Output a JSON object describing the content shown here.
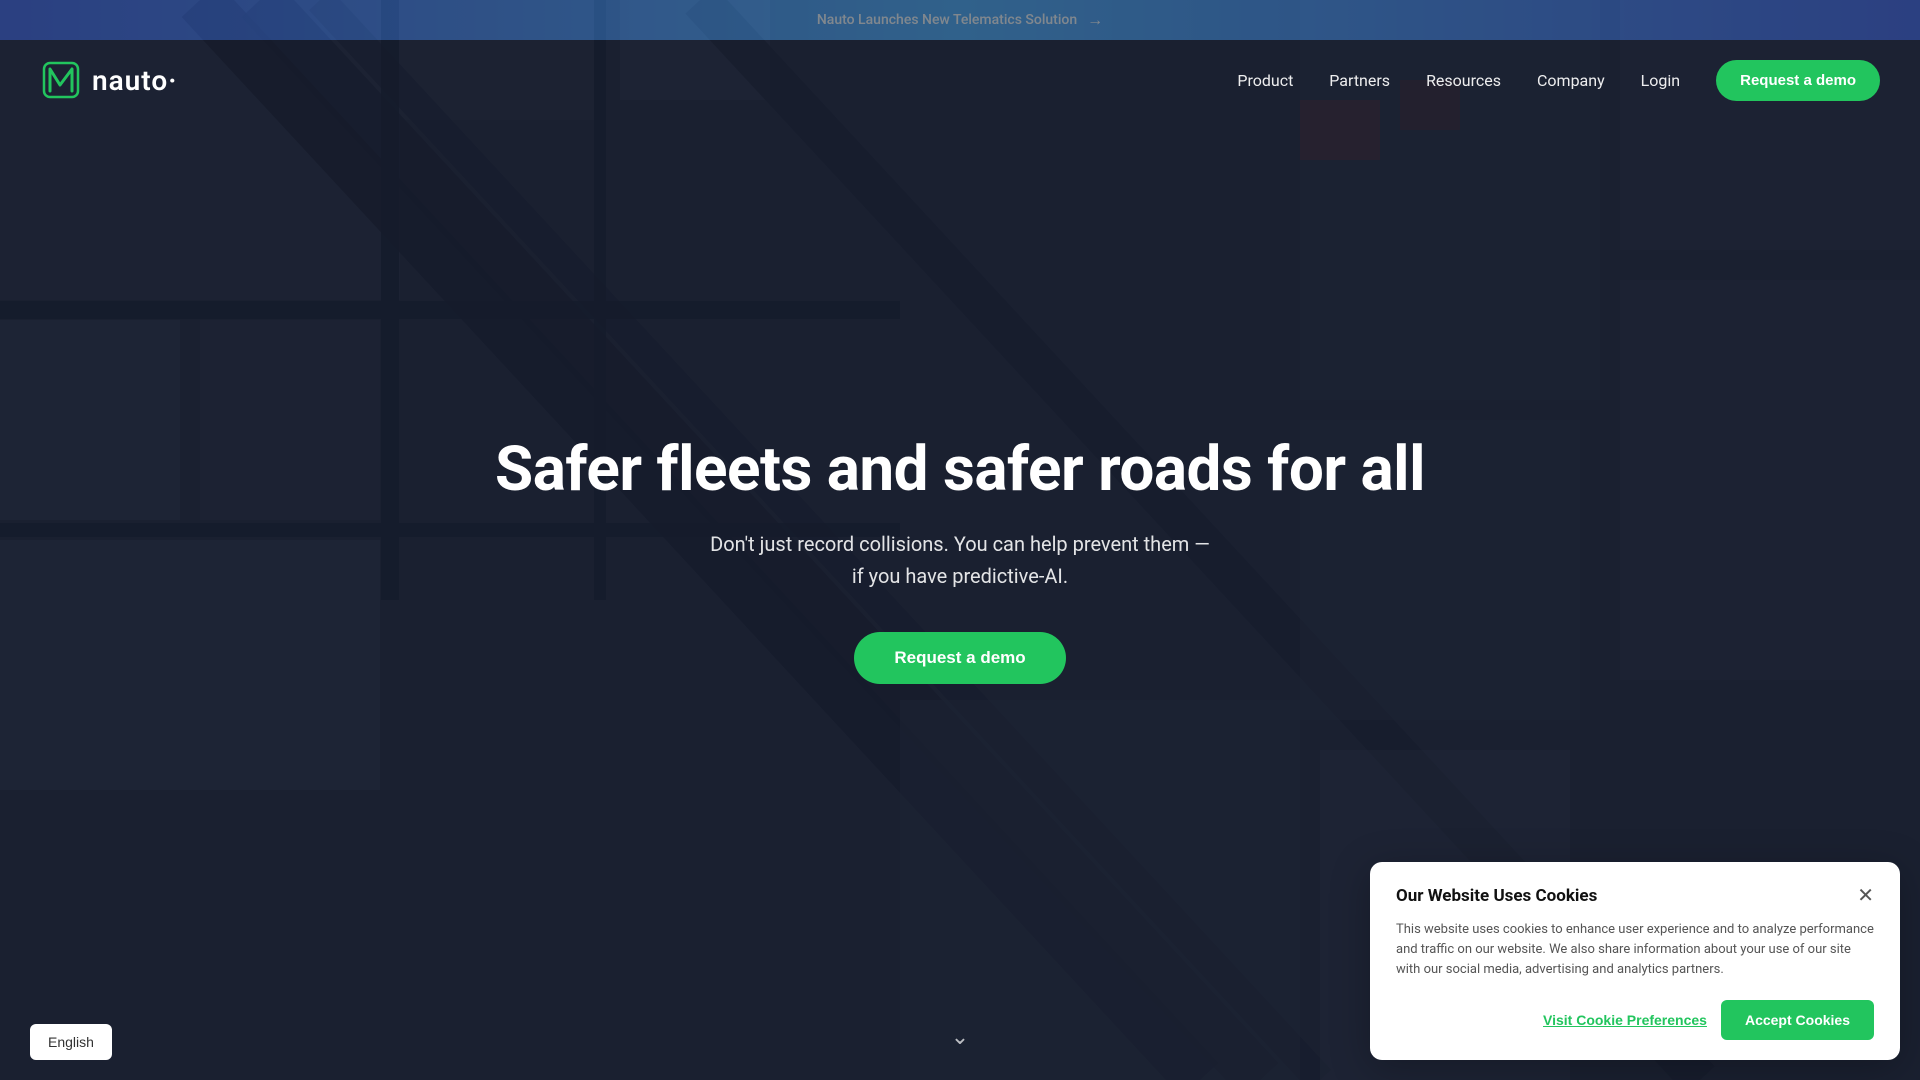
{
  "announcement": {
    "text": "Nauto Launches New Telematics Solution",
    "arrow": "→"
  },
  "navbar": {
    "logo_text": "nauto·",
    "links": [
      {
        "label": "Product",
        "id": "product"
      },
      {
        "label": "Partners",
        "id": "partners"
      },
      {
        "label": "Resources",
        "id": "resources"
      },
      {
        "label": "Company",
        "id": "company"
      },
      {
        "label": "Login",
        "id": "login"
      }
    ],
    "cta_label": "Request a demo"
  },
  "hero": {
    "title": "Safer fleets and safer roads for all",
    "subtitle_line1": "Don't just record collisions. You can help prevent them —",
    "subtitle_line2": "if you have predictive-AI.",
    "cta_label": "Request a demo"
  },
  "language": {
    "label": "English"
  },
  "cookie_banner": {
    "title": "Our Website Uses Cookies",
    "body": "This website uses cookies to enhance user experience and to analyze performance and traffic on our website. We also share information about your use of our site with our social media, advertising and analytics partners.",
    "prefs_label": "Visit Cookie Preferences",
    "accept_label": "Accept Cookies"
  }
}
